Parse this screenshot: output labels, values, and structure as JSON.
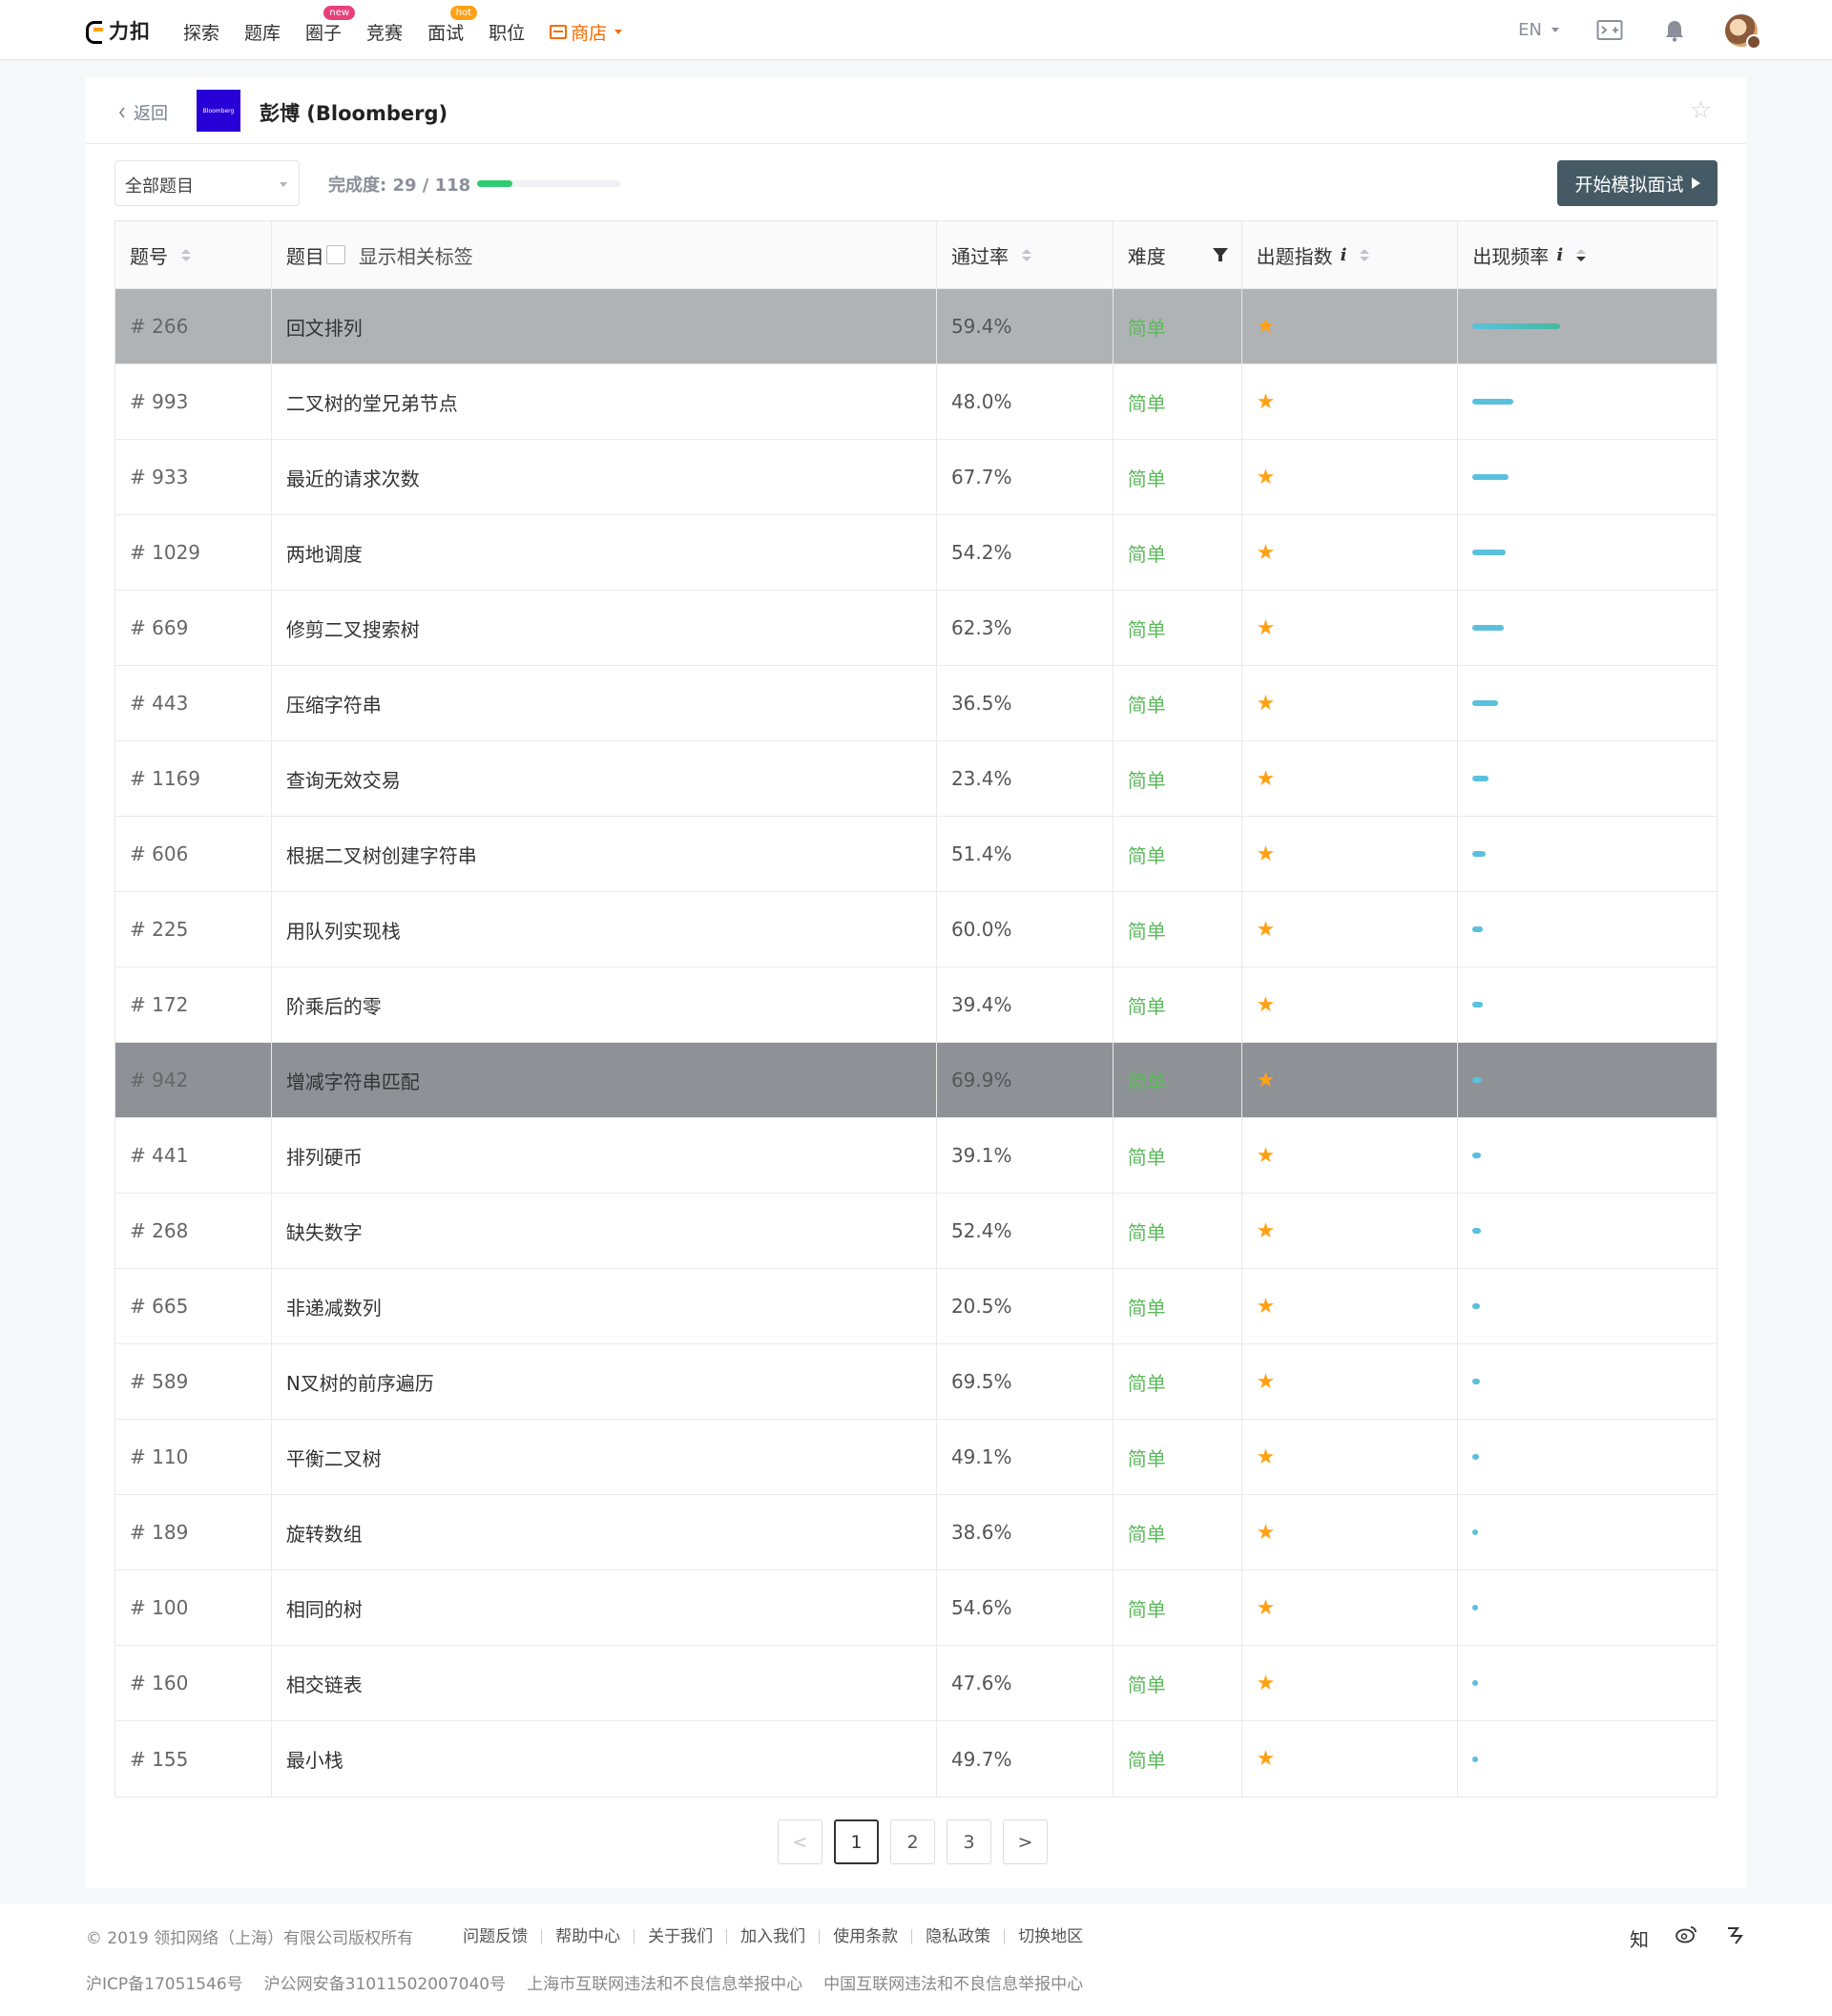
{
  "nav": {
    "logo_text": "力扣",
    "items": [
      {
        "label": "探索",
        "badge": ""
      },
      {
        "label": "题库",
        "badge": ""
      },
      {
        "label": "圈子",
        "badge": "new"
      },
      {
        "label": "竞赛",
        "badge": ""
      },
      {
        "label": "面试",
        "badge": "hot"
      },
      {
        "label": "职位",
        "badge": ""
      }
    ],
    "store_label": "商店",
    "lang_label": "EN",
    "accent_color": "#f56c00"
  },
  "header": {
    "back_label": "返回",
    "logo_text": "Bloomberg",
    "company_name": "彭博 (Bloomberg)"
  },
  "toolbar": {
    "filter_value": "全部题目",
    "progress_label": "完成度: 29 / 118",
    "progress_done": 29,
    "progress_total": 118,
    "mock_button_label": "开始模拟面试"
  },
  "table": {
    "headers": {
      "id": "题号",
      "title": "题目",
      "show_tags": "显示相关标签",
      "rate": "通过率",
      "difficulty": "难度",
      "index": "出题指数",
      "frequency": "出现频率",
      "info_glyph": "i"
    },
    "rows": [
      {
        "id": "# 266",
        "title": "回文排列",
        "rate": "59.4%",
        "difficulty": "简单",
        "freq": 0.92
      },
      {
        "id": "# 993",
        "title": "二叉树的堂兄弟节点",
        "rate": "48.0%",
        "difficulty": "简单",
        "freq": 0.43
      },
      {
        "id": "# 933",
        "title": "最近的请求次数",
        "rate": "67.7%",
        "difficulty": "简单",
        "freq": 0.38
      },
      {
        "id": "# 1029",
        "title": "两地调度",
        "rate": "54.2%",
        "difficulty": "简单",
        "freq": 0.35
      },
      {
        "id": "# 669",
        "title": "修剪二叉搜索树",
        "rate": "62.3%",
        "difficulty": "简单",
        "freq": 0.33
      },
      {
        "id": "# 443",
        "title": "压缩字符串",
        "rate": "36.5%",
        "difficulty": "简单",
        "freq": 0.27
      },
      {
        "id": "# 1169",
        "title": "查询无效交易",
        "rate": "23.4%",
        "difficulty": "简单",
        "freq": 0.17
      },
      {
        "id": "# 606",
        "title": "根据二叉树创建字符串",
        "rate": "51.4%",
        "difficulty": "简单",
        "freq": 0.14
      },
      {
        "id": "# 225",
        "title": "用队列实现栈",
        "rate": "60.0%",
        "difficulty": "简单",
        "freq": 0.11
      },
      {
        "id": "# 172",
        "title": "阶乘后的零",
        "rate": "39.4%",
        "difficulty": "简单",
        "freq": 0.11
      },
      {
        "id": "# 942",
        "title": "增减字符串匹配",
        "rate": "69.9%",
        "difficulty": "简单",
        "freq": 0.1
      },
      {
        "id": "# 441",
        "title": "排列硬币",
        "rate": "39.1%",
        "difficulty": "简单",
        "freq": 0.09
      },
      {
        "id": "# 268",
        "title": "缺失数字",
        "rate": "52.4%",
        "difficulty": "简单",
        "freq": 0.09
      },
      {
        "id": "# 665",
        "title": "非递减数列",
        "rate": "20.5%",
        "difficulty": "简单",
        "freq": 0.08
      },
      {
        "id": "# 589",
        "title": "N叉树的前序遍历",
        "rate": "69.5%",
        "difficulty": "简单",
        "freq": 0.08
      },
      {
        "id": "# 110",
        "title": "平衡二叉树",
        "rate": "49.1%",
        "difficulty": "简单",
        "freq": 0.07
      },
      {
        "id": "# 189",
        "title": "旋转数组",
        "rate": "38.6%",
        "difficulty": "简单",
        "freq": 0.06
      },
      {
        "id": "# 100",
        "title": "相同的树",
        "rate": "54.6%",
        "difficulty": "简单",
        "freq": 0.06
      },
      {
        "id": "# 160",
        "title": "相交链表",
        "rate": "47.6%",
        "difficulty": "简单",
        "freq": 0.06
      },
      {
        "id": "# 155",
        "title": "最小栈",
        "rate": "49.7%",
        "difficulty": "简单",
        "freq": 0.06
      }
    ],
    "difficulty_color": "#5cb85c",
    "star_color": "#ffa116",
    "freq_color": "#5bc0de"
  },
  "pagination": {
    "prev": "<",
    "pages": [
      "1",
      "2",
      "3"
    ],
    "next": ">",
    "current": "1"
  },
  "footer": {
    "copyright": "© 2019 领扣网络（上海）有限公司版权所有",
    "links": [
      "问题反馈",
      "帮助中心",
      "关于我们",
      "加入我们",
      "使用条款",
      "隐私政策",
      "切换地区"
    ],
    "legal": [
      "沪ICP备17051546号",
      "沪公网安备31011502007040号",
      "上海市互联网违法和不良信息举报中心",
      "中国互联网违法和不良信息举报中心"
    ],
    "social": [
      "知",
      "weibo-icon",
      "wechat-icon"
    ]
  }
}
